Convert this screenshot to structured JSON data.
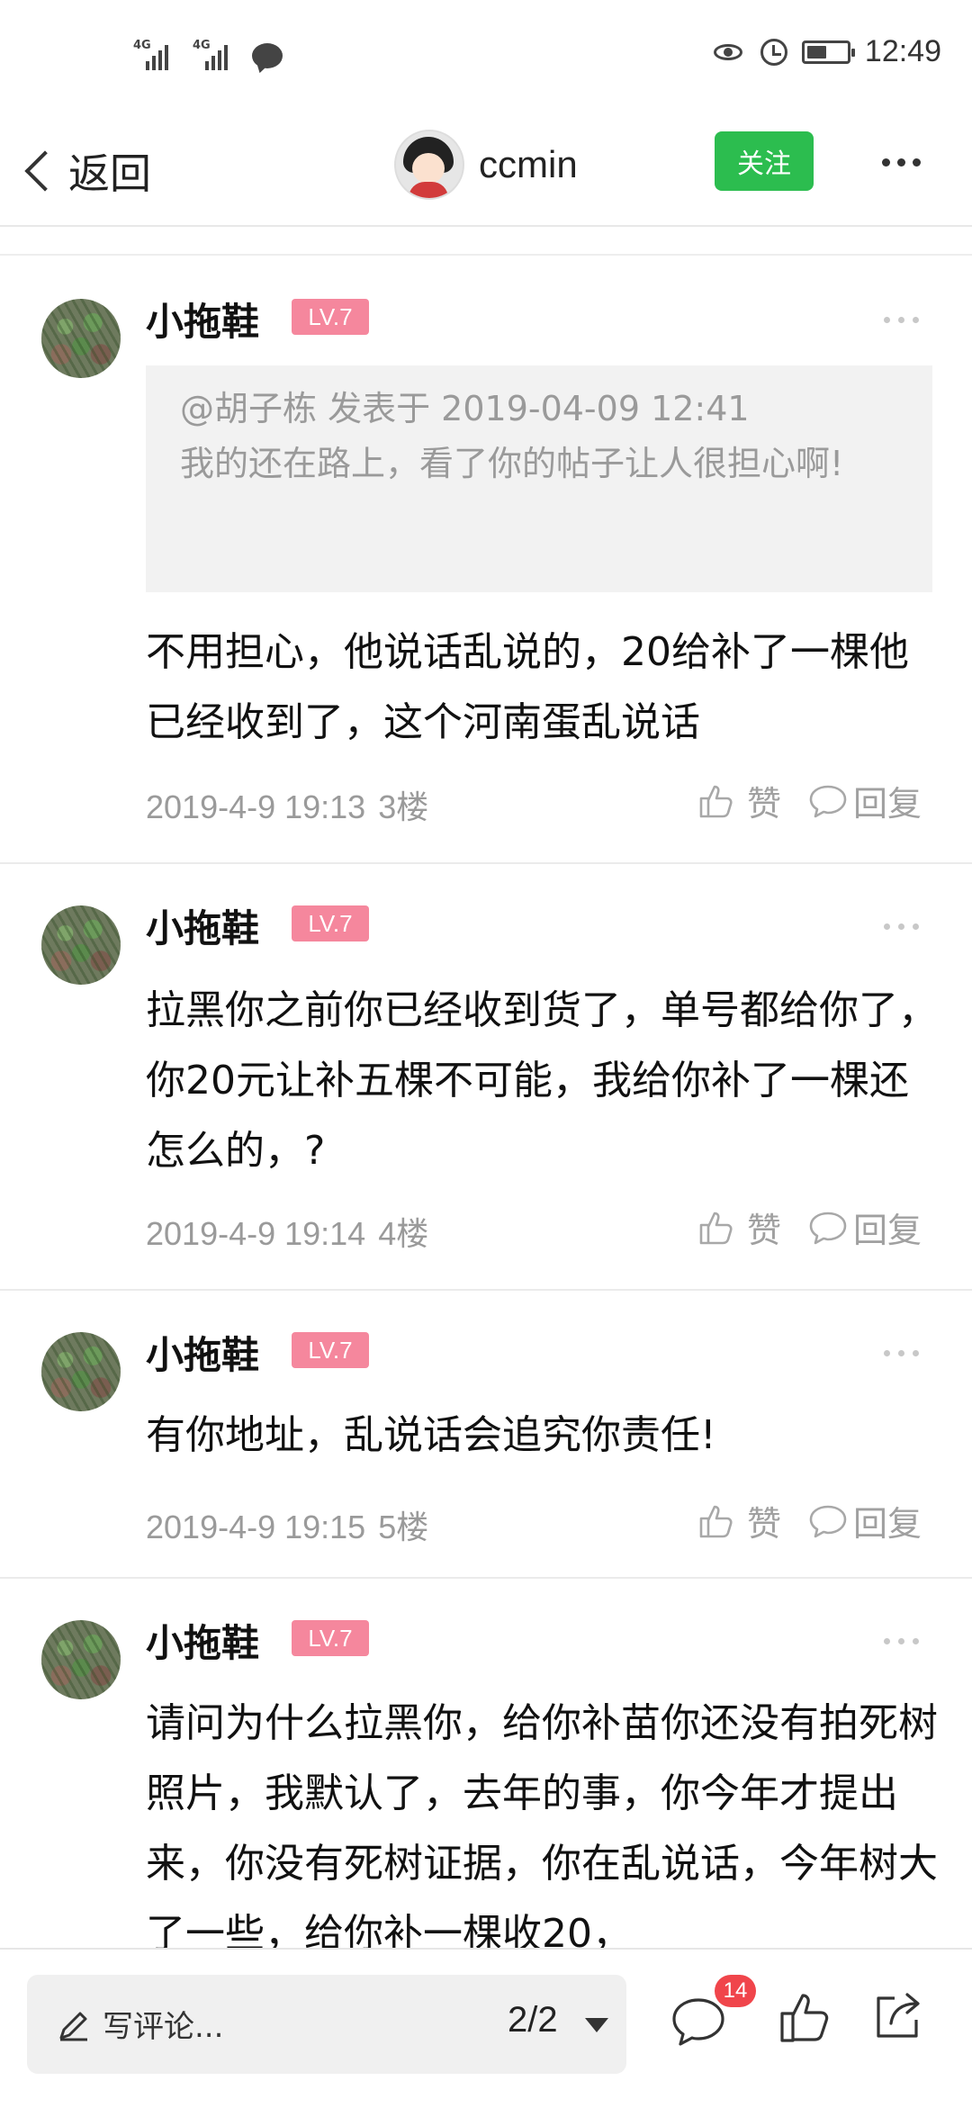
{
  "status_bar": {
    "signal1_label": "4G",
    "signal2_label": "4G",
    "time": "12:49",
    "battery_level": 0.5
  },
  "header": {
    "back_label": "返回",
    "author_name": "ccmin",
    "follow_label": "关注"
  },
  "comments": [
    {
      "name": "小拖鞋",
      "level": "LV.7",
      "quote_head": "@胡子栋 发表于 2019-04-09 12:41",
      "quote_text": "我的还在路上，看了你的帖子让人很担心啊!",
      "body": "不用担心，他说话乱说的，20给补了一棵他已经收到了，这个河南蛋乱说话",
      "time": "2019-4-9 19:13",
      "floor": "3楼",
      "like_label": "赞",
      "reply_label": "回复"
    },
    {
      "name": "小拖鞋",
      "level": "LV.7",
      "body": "拉黑你之前你已经收到货了，单号都给你了，你20元让补五棵不可能，我给你补了一棵还怎么的，?",
      "time": "2019-4-9 19:14",
      "floor": "4楼",
      "like_label": "赞",
      "reply_label": "回复"
    },
    {
      "name": "小拖鞋",
      "level": "LV.7",
      "body": "有你地址，乱说话会追究你责任!",
      "time": "2019-4-9 19:15",
      "floor": "5楼",
      "like_label": "赞",
      "reply_label": "回复"
    },
    {
      "name": "小拖鞋",
      "level": "LV.7",
      "body": "请问为什么拉黑你，给你补苗你还没有拍死树照片，我默认了，去年的事，你今年才提出来，你没有死树证据，你在乱说话，今年树大了一些，给你补一棵收20，"
    }
  ],
  "bottom_bar": {
    "comment_placeholder": "写评论...",
    "page_indicator": "2/2",
    "comment_count": "14"
  },
  "colors": {
    "follow_green": "#2cbd4f",
    "level_pink": "#f5879d",
    "badge_red": "#f0454b"
  },
  "icons": [
    "back-icon",
    "more-icon",
    "thumb-up-icon",
    "comment-icon",
    "pencil-icon",
    "share-icon",
    "eye-icon",
    "alarm-icon",
    "battery-icon",
    "chat-icon"
  ]
}
